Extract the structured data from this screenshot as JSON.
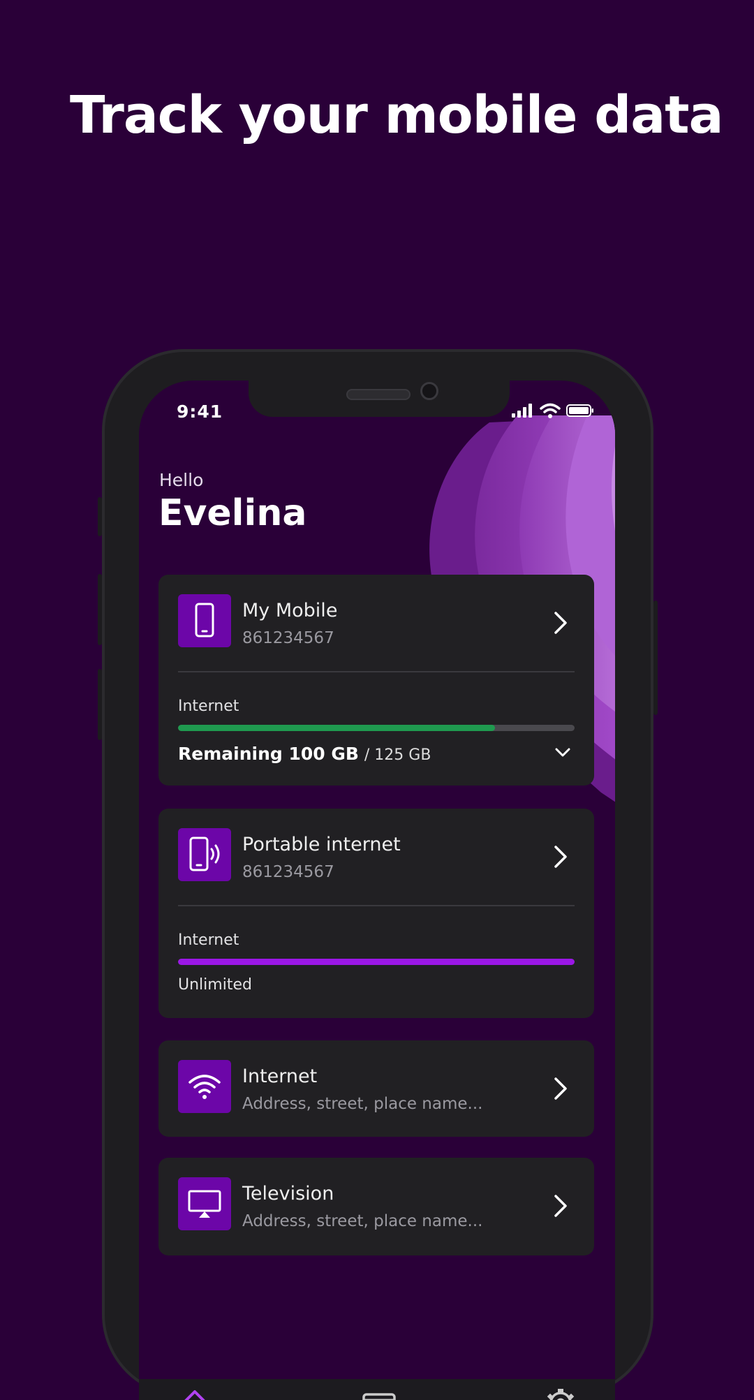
{
  "headline": "Track your mobile data",
  "status_bar": {
    "time": "9:41",
    "signal_icon": "signal-icon",
    "wifi_icon": "wifi-icon",
    "battery_icon": "battery-icon"
  },
  "greeting": {
    "hello": "Hello",
    "name": "Evelina"
  },
  "cards": [
    {
      "title": "My Mobile",
      "subtitle": "861234567",
      "icon": "smartphone-icon",
      "usage_label": "Internet",
      "remaining_label": "Remaining 100 GB",
      "total_label": "/ 125 GB",
      "usage_fraction": 0.8
    },
    {
      "title": "Portable internet",
      "subtitle": "861234567",
      "icon": "portable-internet-icon",
      "usage_label": "Internet",
      "plan_label": "Unlimited"
    },
    {
      "title": "Internet",
      "subtitle": "Address, street, place name...",
      "icon": "wifi-icon"
    },
    {
      "title": "Television",
      "subtitle": "Address, street, place name...",
      "icon": "tv-icon"
    }
  ],
  "nav": {
    "items": [
      "home-icon",
      "wallet-icon",
      "settings-icon"
    ]
  },
  "colors": {
    "background": "#2a0038",
    "accent": "#6c06a8",
    "progress_green": "#1f9a4f",
    "progress_purple": "#9b17e6",
    "card": "#212023"
  }
}
